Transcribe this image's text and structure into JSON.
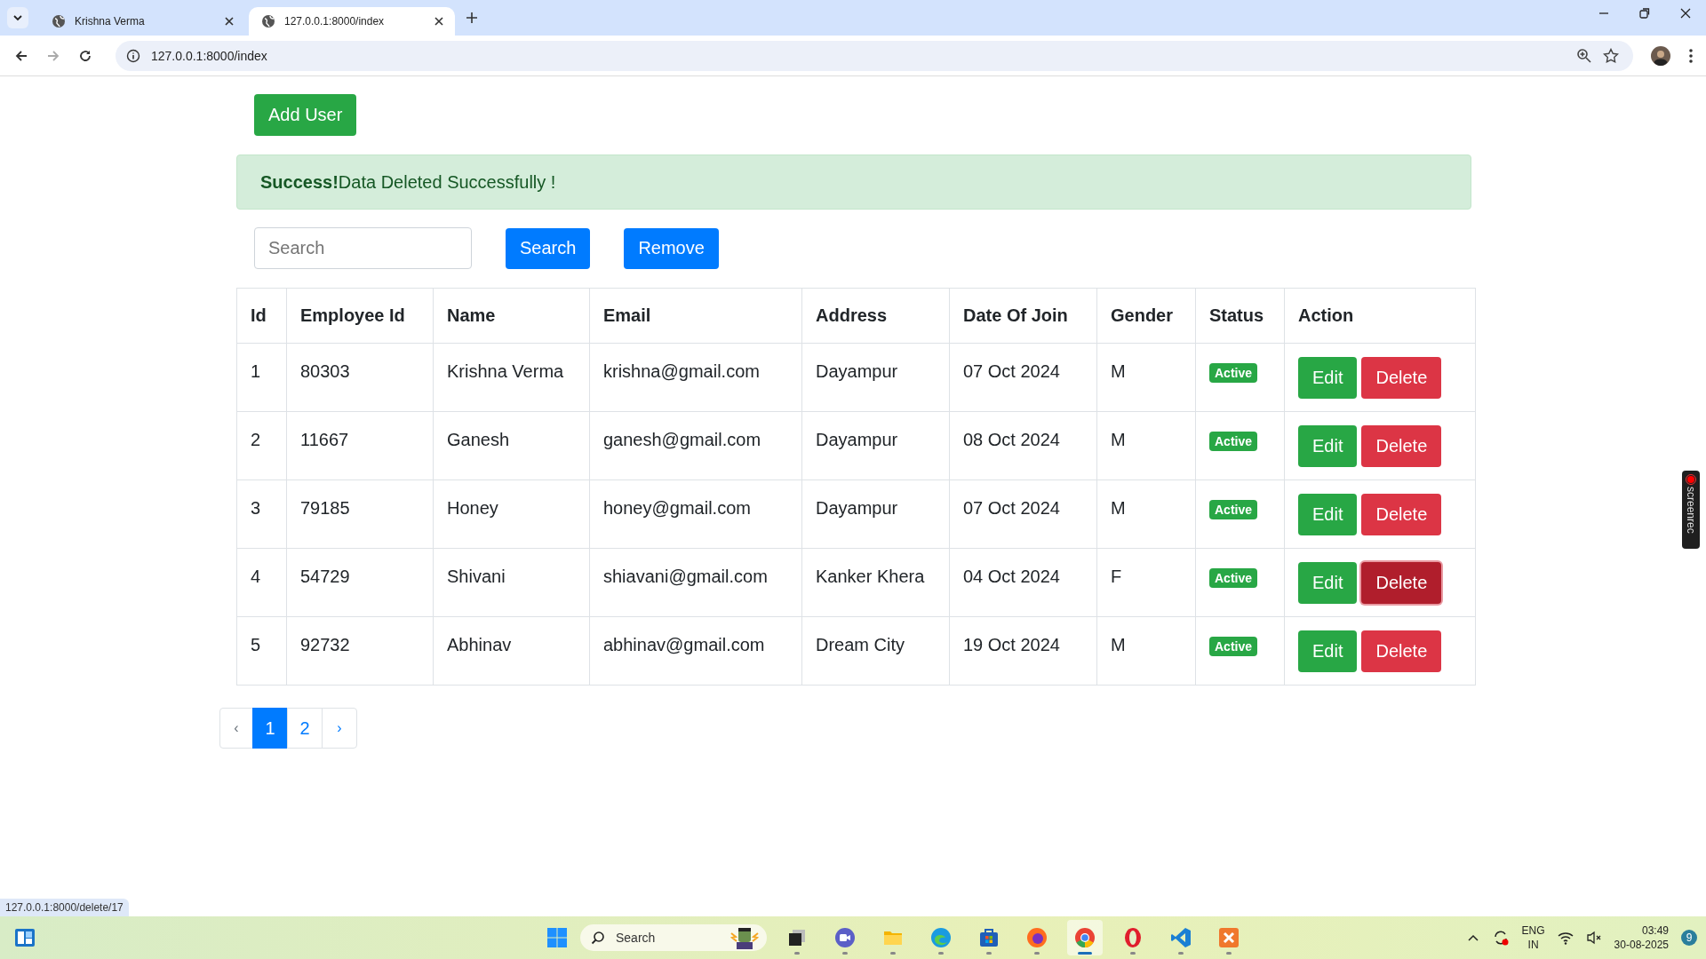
{
  "browser": {
    "tabs": [
      {
        "title": "Krishna Verma",
        "selected": false
      },
      {
        "title": "127.0.0.1:8000/index",
        "selected": true
      }
    ],
    "address": "127.0.0.1:8000/index",
    "status_url": "127.0.0.1:8000/delete/17"
  },
  "page": {
    "add_button": "Add User",
    "alert": {
      "title": "Success!",
      "message": "Data Deleted Successfully !"
    },
    "search": {
      "placeholder": "Search",
      "search_button": "Search",
      "remove_button": "Remove"
    },
    "table": {
      "columns": [
        "Id",
        "Employee Id",
        "Name",
        "Email",
        "Address",
        "Date Of Join",
        "Gender",
        "Status",
        "Action"
      ],
      "rows": [
        {
          "id": "1",
          "employee_id": "80303",
          "name": "Krishna Verma",
          "email": "krishna@gmail.com",
          "address": "Dayampur",
          "date_of_join": "07 Oct 2024",
          "gender": "M",
          "status": "Active",
          "edit": "Edit",
          "delete": "Delete",
          "delete_hovered": false
        },
        {
          "id": "2",
          "employee_id": "11667",
          "name": "Ganesh",
          "email": "ganesh@gmail.com",
          "address": "Dayampur",
          "date_of_join": "08 Oct 2024",
          "gender": "M",
          "status": "Active",
          "edit": "Edit",
          "delete": "Delete",
          "delete_hovered": false
        },
        {
          "id": "3",
          "employee_id": "79185",
          "name": "Honey",
          "email": "honey@gmail.com",
          "address": "Dayampur",
          "date_of_join": "07 Oct 2024",
          "gender": "M",
          "status": "Active",
          "edit": "Edit",
          "delete": "Delete",
          "delete_hovered": false
        },
        {
          "id": "4",
          "employee_id": "54729",
          "name": "Shivani",
          "email": "shiavani@gmail.com",
          "address": "Kanker Khera",
          "date_of_join": "04 Oct 2024",
          "gender": "F",
          "status": "Active",
          "edit": "Edit",
          "delete": "Delete",
          "delete_hovered": true
        },
        {
          "id": "5",
          "employee_id": "92732",
          "name": "Abhinav",
          "email": "abhinav@gmail.com",
          "address": "Dream City",
          "date_of_join": "19 Oct 2024",
          "gender": "M",
          "status": "Active",
          "edit": "Edit",
          "delete": "Delete",
          "delete_hovered": false
        }
      ]
    },
    "pagination": {
      "prev": "‹",
      "next": "›",
      "pages": [
        {
          "label": "1",
          "selected": true
        },
        {
          "label": "2",
          "selected": false
        }
      ]
    }
  },
  "recorder_badge": "screenrec",
  "taskbar": {
    "search_placeholder": "Search",
    "apps": [
      {
        "kind": "files",
        "selected": false
      },
      {
        "kind": "chat",
        "selected": false
      },
      {
        "kind": "folder",
        "selected": false
      },
      {
        "kind": "edge",
        "selected": false
      },
      {
        "kind": "store",
        "selected": false
      },
      {
        "kind": "firefox",
        "selected": false
      },
      {
        "kind": "chrome",
        "selected": true
      },
      {
        "kind": "opera",
        "selected": false
      },
      {
        "kind": "vscode",
        "selected": false
      },
      {
        "kind": "xampp",
        "selected": false
      }
    ],
    "language": "ENG",
    "region": "IN",
    "time": "03:49",
    "date": "30-08-2025",
    "notifications": "9"
  }
}
